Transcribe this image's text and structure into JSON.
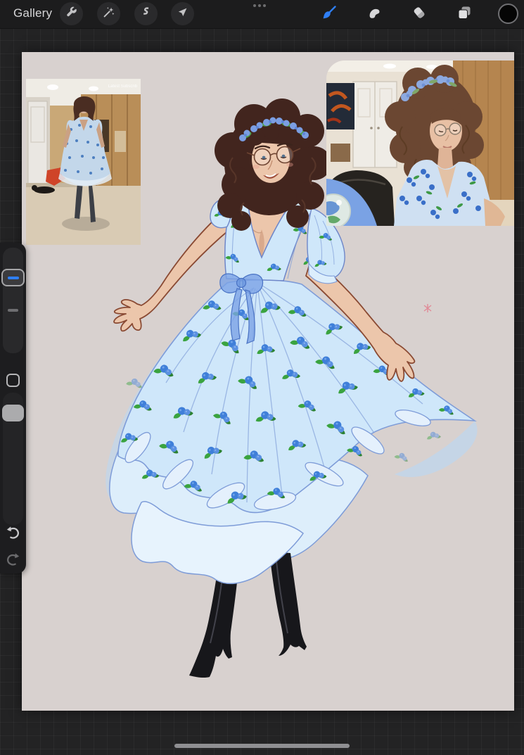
{
  "toolbar": {
    "gallery_label": "Gallery",
    "left_tools": [
      {
        "name": "actions",
        "icon": "wrench-icon"
      },
      {
        "name": "adjustments",
        "icon": "magic-wand-icon"
      },
      {
        "name": "selection",
        "icon": "s-curve-icon"
      },
      {
        "name": "transform",
        "icon": "arrow-cursor-icon"
      }
    ],
    "menu_dots_count": 3,
    "right_tools": [
      {
        "name": "paint",
        "icon": "brush-icon",
        "active": true
      },
      {
        "name": "smudge",
        "icon": "smudge-icon",
        "active": false
      },
      {
        "name": "erase",
        "icon": "eraser-icon",
        "active": false
      },
      {
        "name": "layers",
        "icon": "layers-icon",
        "active": false
      },
      {
        "name": "color",
        "icon": "color-swatch-icon",
        "active": false
      }
    ],
    "accent_color": "#2f7ff6",
    "current_color": "#050505"
  },
  "sidebar": {
    "controls": [
      "brush-size-slider",
      "modify-button",
      "opacity-slider",
      "undo-button",
      "redo-button"
    ],
    "brush_size_thumb_color": "#2f7ff6"
  },
  "canvas": {
    "background_color": "#d8d1cf",
    "artwork_subject": "figure in blue blueberry-print dress with flower crown, glasses and black heeled boots",
    "photos": [
      {
        "position": "top-left",
        "overlay_text": "Latest Subscrib"
      },
      {
        "position": "top-right",
        "overlay_text": ""
      }
    ]
  },
  "home_indicator": {
    "visible": true
  }
}
